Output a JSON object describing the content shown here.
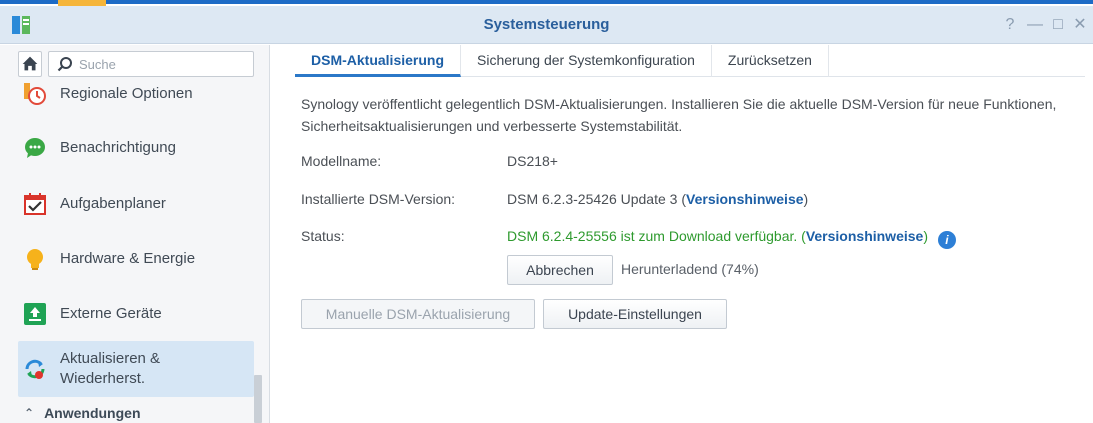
{
  "window": {
    "title": "Systemsteuerung",
    "controls": {
      "help": "?",
      "minimize": "—",
      "maximize": "□",
      "close": "✕"
    }
  },
  "sidebar": {
    "search_placeholder": "Suche",
    "items": [
      {
        "label": "Regionale Optionen",
        "icon": "region-clock-icon"
      },
      {
        "label": "Benachrichtigung",
        "icon": "chat-bubble-icon"
      },
      {
        "label": "Aufgabenplaner",
        "icon": "calendar-check-icon"
      },
      {
        "label": "Hardware & Energie",
        "icon": "light-bulb-icon"
      },
      {
        "label": "Externe Geräte",
        "icon": "upload-box-icon"
      },
      {
        "label": "Aktualisieren &\nWiederherst.",
        "icon": "refresh-icon"
      }
    ],
    "section": {
      "label": "Anwendungen"
    }
  },
  "tabs": [
    {
      "label": "DSM-Aktualisierung",
      "active": true
    },
    {
      "label": "Sicherung der Systemkonfiguration",
      "active": false
    },
    {
      "label": "Zurücksetzen",
      "active": false
    }
  ],
  "content": {
    "description": "Synology veröffentlicht gelegentlich DSM-Aktualisierungen. Installieren Sie die aktuelle DSM-Version für neue Funktionen, Sicherheitsaktualisierungen und verbesserte Systemstabilität.",
    "model_label": "Modellname:",
    "model_value": "DS218+",
    "installed_label": "Installierte DSM-Version:",
    "installed_value": "DSM 6.2.3-25426 Update 3",
    "installed_open": "(",
    "installed_link": "Versionshinweise",
    "installed_close": ")",
    "status_label": "Status:",
    "status_value": "DSM 6.2.4-25556 ist zum Download verfügbar.",
    "status_open": "(",
    "status_link": "Versionshinweise",
    "status_close": ")",
    "cancel_button": "Abbrechen",
    "progress_text": "Herunterladend (74%)",
    "progress_percent": 74,
    "manual_update_button": "Manuelle DSM-Aktualisierung",
    "update_settings_button": "Update-Einstellungen"
  },
  "colors": {
    "accent": "#2b78c8",
    "link": "#1d5fa6",
    "status_green": "#2e9a2e",
    "titlebar": "#dde8f3",
    "active_item": "#d6e6f5"
  }
}
